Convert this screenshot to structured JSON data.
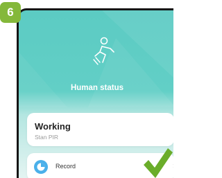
{
  "step_badge": "6",
  "header": {
    "title": "Human status",
    "icon": "running-person-icon"
  },
  "status_card": {
    "value": "Working",
    "subtitle": "Stan PIR"
  },
  "record_row": {
    "label": "Record",
    "icon": "record-icon",
    "chevron": "›"
  },
  "colors": {
    "header_teal": "#5ccbc3",
    "badge_green": "#84b83a",
    "check_green": "#6aad2a",
    "record_icon_blue": "#4ab0ea"
  }
}
